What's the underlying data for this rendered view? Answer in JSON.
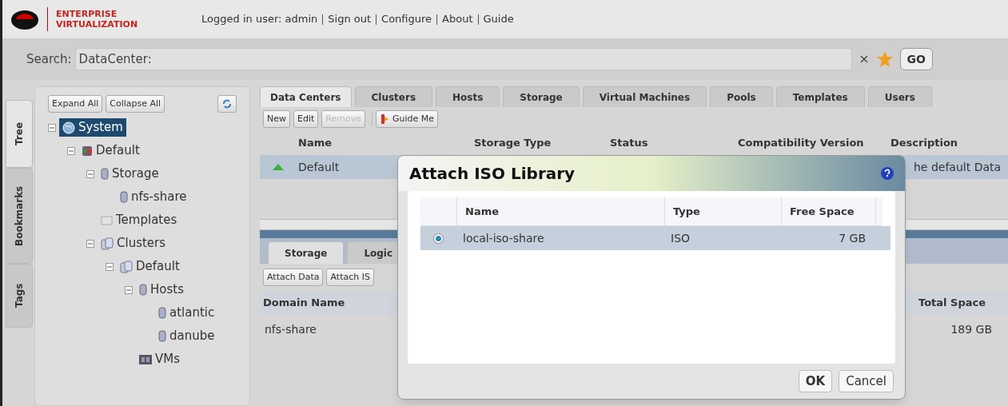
{
  "header": {
    "brand_line1": "ENTERPRISE",
    "brand_line2": "VIRTUALIZATION",
    "links": [
      "Logged in user: admin",
      "Sign out",
      "Configure",
      "About",
      "Guide"
    ]
  },
  "search": {
    "label": "Search:",
    "value": "DataCenter:",
    "clear": "×",
    "go": "GO"
  },
  "side_tabs": [
    {
      "label": "Tree",
      "selected": true
    },
    {
      "label": "Bookmarks",
      "selected": false
    },
    {
      "label": "Tags",
      "selected": false
    }
  ],
  "tree_buttons": [
    "Expand All",
    "Collapse All"
  ],
  "tree": [
    {
      "label": "System",
      "kind": "globe",
      "selected": true,
      "expanded": true,
      "children": [
        {
          "label": "Default",
          "kind": "datacenter",
          "selected": false,
          "expanded": true,
          "children": [
            {
              "label": "Storage",
              "kind": "disk",
              "selected": false,
              "expanded": true,
              "children": [
                {
                  "label": "nfs-share",
                  "kind": "disk",
                  "selected": false
                }
              ]
            },
            {
              "label": "Templates",
              "kind": "template",
              "selected": false
            },
            {
              "label": "Clusters",
              "kind": "cluster",
              "selected": false,
              "expanded": true,
              "children": [
                {
                  "label": "Default",
                  "kind": "cluster",
                  "selected": false,
                  "expanded": true,
                  "children": [
                    {
                      "label": "Hosts",
                      "kind": "disk",
                      "selected": false,
                      "expanded": true,
                      "children": [
                        {
                          "label": "atlantic",
                          "kind": "disk",
                          "selected": false
                        },
                        {
                          "label": "danube",
                          "kind": "disk",
                          "selected": false
                        }
                      ]
                    },
                    {
                      "label": "VMs",
                      "kind": "vm",
                      "selected": false
                    }
                  ]
                }
              ]
            }
          ]
        }
      ]
    }
  ],
  "main_tabs": [
    {
      "label": "Data Centers",
      "selected": true
    },
    {
      "label": "Clusters",
      "selected": false
    },
    {
      "label": "Hosts",
      "selected": false
    },
    {
      "label": "Storage",
      "selected": false
    },
    {
      "label": "Virtual Machines",
      "selected": false
    },
    {
      "label": "Pools",
      "selected": false
    },
    {
      "label": "Templates",
      "selected": false
    },
    {
      "label": "Users",
      "selected": false
    }
  ],
  "toolbar": [
    {
      "label": "New",
      "disabled": false
    },
    {
      "label": "Edit",
      "disabled": false
    },
    {
      "label": "Remove",
      "disabled": true
    },
    {
      "label": "Guide Me",
      "disabled": false
    }
  ],
  "table": {
    "columns": [
      "Name",
      "Storage Type",
      "Status",
      "Compatibility Version",
      "Description"
    ],
    "rows": [
      {
        "selected": true,
        "name": "Default",
        "description": "he default Data"
      }
    ]
  },
  "sub_tabs": [
    {
      "label": "Storage",
      "selected": true
    },
    {
      "label": "Logic",
      "selected": false
    }
  ],
  "sub_toolbar": [
    "Attach Data",
    "Attach IS"
  ],
  "sub_table": {
    "columns": [
      "Domain Name",
      "Total Space"
    ],
    "rows": [
      {
        "domain_name": "nfs-share",
        "total_space": "189 GB"
      }
    ]
  },
  "dialog": {
    "title": "Attach ISO Library",
    "columns": [
      "Name",
      "Type",
      "Free Space"
    ],
    "rows": [
      {
        "selected": true,
        "name": "local-iso-share",
        "type": "ISO",
        "free_space": "7 GB"
      }
    ],
    "buttons": [
      "OK",
      "Cancel"
    ]
  }
}
